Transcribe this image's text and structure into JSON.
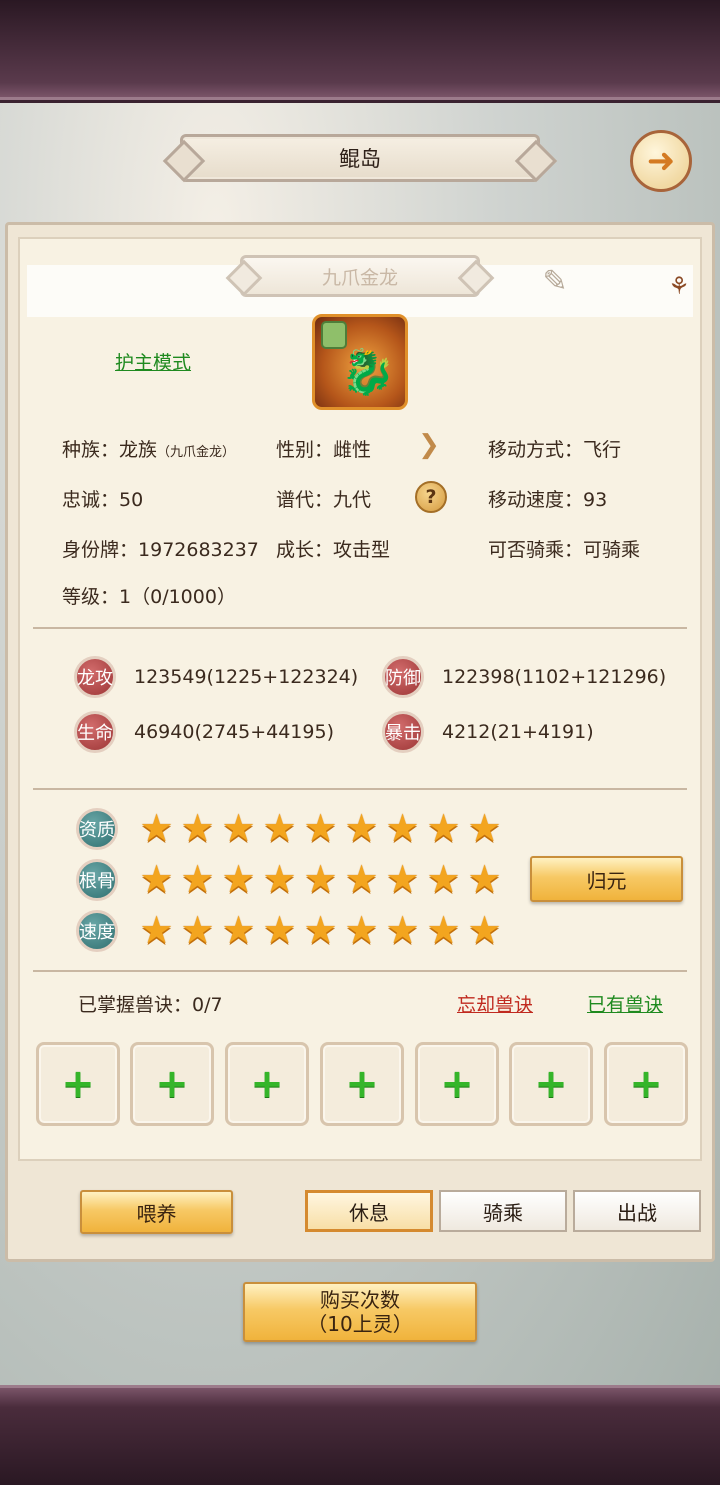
{
  "header": {
    "title": "鲲岛",
    "back_icon": "back-arrow-icon"
  },
  "pet": {
    "name": "九爪金龙",
    "mode": "护主模式",
    "race_label": "种族：",
    "race_value": "龙族",
    "race_sub": "（九爪金龙）",
    "gender_label": "性别：",
    "gender_value": "雌性",
    "move_label": "移动方式：",
    "move_value": "飞行",
    "loyalty_label": "忠诚：",
    "loyalty_value": "50",
    "gen_label": "谱代：",
    "gen_value": "九代",
    "speed_label": "移动速度：",
    "speed_value": "93",
    "id_label": "身份牌：",
    "id_value": "1972683237",
    "growth_label": "成长：",
    "growth_value": "攻击型",
    "ride_label": "可否骑乘：",
    "ride_value": "可骑乘",
    "level_label": "等级：",
    "level_value": "1（0/1000）"
  },
  "stats": [
    {
      "badge": "龙攻",
      "value": "123549(1225+122324)"
    },
    {
      "badge": "防御",
      "value": "122398(1102+121296)"
    },
    {
      "badge": "生命",
      "value": "46940(2745+44195)"
    },
    {
      "badge": "暴击",
      "value": "4212(21+4191)"
    }
  ],
  "star_rows": [
    {
      "badge": "资质",
      "stars": 9
    },
    {
      "badge": "根骨",
      "stars": 9
    },
    {
      "badge": "速度",
      "stars": 9
    }
  ],
  "reset_button": "归元",
  "skills": {
    "label": "已掌握兽诀：0/7",
    "forget": "忘却兽诀",
    "owned": "已有兽诀",
    "slots": 7
  },
  "actions": {
    "feed": "喂养",
    "rest": "休息",
    "ride": "骑乘",
    "battle": "出战"
  },
  "buy": {
    "line1": "购买次数",
    "line2": "（10上灵）"
  },
  "colors": {
    "accent_gold": "#f0b33c",
    "link_green": "#1f8a1f",
    "link_red": "#c02a1f",
    "star": "#f3a51f"
  }
}
